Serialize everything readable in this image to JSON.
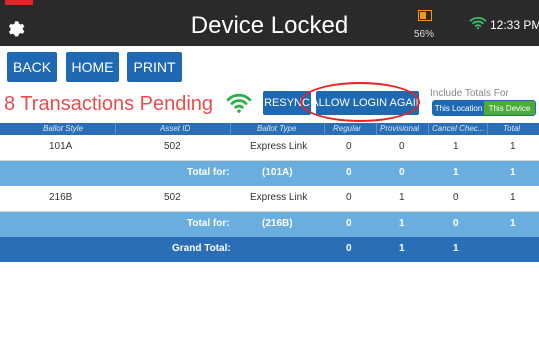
{
  "header": {
    "title": "Device Locked",
    "battery": "56%",
    "time": "12:33 PM"
  },
  "nav": {
    "back": "BACK",
    "home": "HOME",
    "print": "PRINT"
  },
  "status": {
    "pending": "8 Transactions Pending",
    "resync": "RESYNC",
    "allow_login": "ALLOW LOGIN AGAIN"
  },
  "totals": {
    "label": "Include Totals For",
    "location": "This Location",
    "device": "This Device"
  },
  "table": {
    "headers": [
      "Ballot Style",
      "Asset ID",
      "Ballot Type",
      "Regular",
      "Provisional",
      "Cancel Chec...",
      "Total"
    ],
    "rows": [
      {
        "style": "101A",
        "asset": "502",
        "type": "Express Link",
        "regular": "0",
        "provisional": "0",
        "cancel": "1",
        "total": "1"
      },
      {
        "label": "Total for:",
        "type": "(101A)",
        "regular": "0",
        "provisional": "0",
        "cancel": "1",
        "total": "1"
      },
      {
        "style": "216B",
        "asset": "502",
        "type": "Express Link",
        "regular": "0",
        "provisional": "1",
        "cancel": "0",
        "total": "1"
      },
      {
        "label": "Total for:",
        "type": "(216B)",
        "regular": "0",
        "provisional": "1",
        "cancel": "0",
        "total": "1"
      },
      {
        "label": "Grand Total:",
        "regular": "0",
        "provisional": "1",
        "cancel": "1"
      }
    ]
  },
  "colors": {
    "header_bg": "#2a2a2a",
    "primary_blue": "#1f69b3",
    "table_header": "#2a6fb6",
    "total_row": "#6aaddf",
    "pending_red": "#e84d4d",
    "device_green": "#4caa38",
    "highlight_red": "#e52626"
  },
  "icons": [
    "settings-gear-icon",
    "battery-icon",
    "wifi-icon",
    "wifi-signal-green-icon"
  ]
}
